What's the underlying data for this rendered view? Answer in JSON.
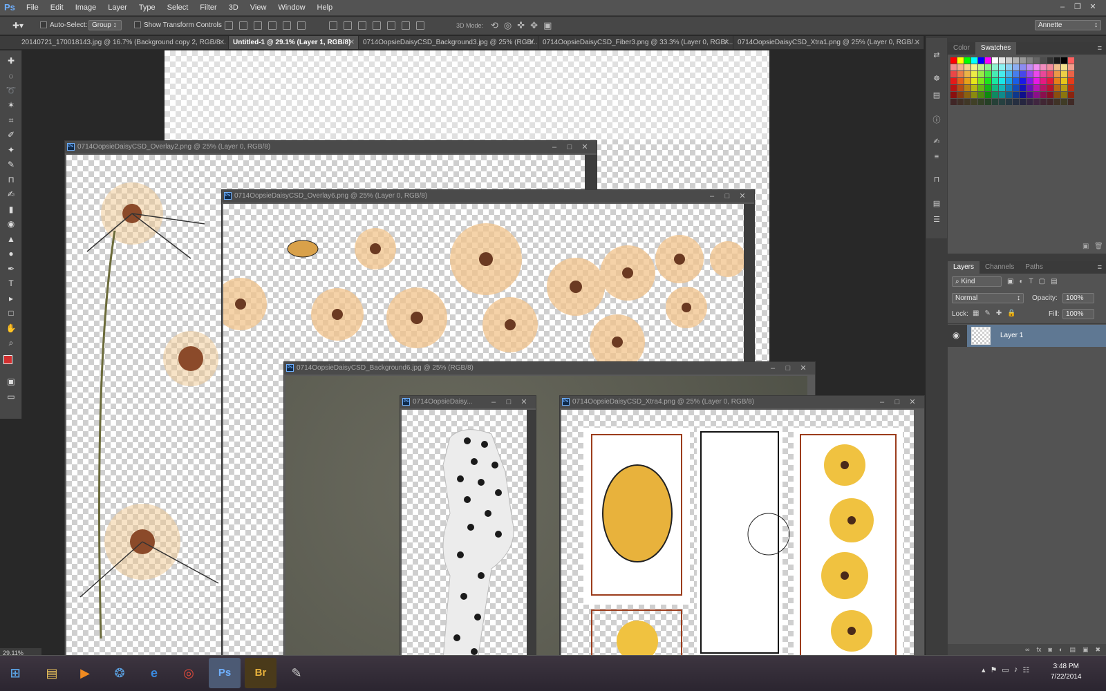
{
  "app": {
    "logo": "Ps"
  },
  "menu": [
    "File",
    "Edit",
    "Image",
    "Layer",
    "Type",
    "Select",
    "Filter",
    "3D",
    "View",
    "Window",
    "Help"
  ],
  "options": {
    "auto_select": "Auto-Select:",
    "group": "Group",
    "show_transform": "Show Transform Controls",
    "mode_3d": "3D Mode:",
    "workspace": "Annette"
  },
  "tabs": [
    "20140721_170018143.jpg @ 16.7% (Background copy 2, RGB/8...",
    "Untitled-1 @ 29.1% (Layer 1, RGB/8)",
    "0714OopsieDaisyCSD_Background3.jpg @ 25% (RGB/...",
    "0714OopsieDaisyCSD_Fiber3.png @ 33.3% (Layer 0, RGB/...",
    "0714OopsieDaisyCSD_Xtra1.png @ 25% (Layer 0, RGB/..."
  ],
  "windows": {
    "overlay2": "0714OopsieDaisyCSD_Overlay2.png @ 25% (Layer 0, RGB/8)",
    "overlay6": "0714OopsieDaisyCSD_Overlay6.png @ 25% (Layer 0, RGB/8)",
    "background6": "0714OopsieDaisyCSD_Background6.jpg @ 25% (RGB/8)",
    "fiber": "0714OopsieDaisy...",
    "xtra4": "0714OopsieDaisyCSD_Xtra4.png @ 25% (Layer 0, RGB/8)"
  },
  "color_panel": {
    "tabs": [
      "Color",
      "Swatches"
    ],
    "active": "Swatches"
  },
  "layers_panel": {
    "tabs": [
      "Layers",
      "Channels",
      "Paths"
    ],
    "filter": "Kind",
    "blend_mode": "Normal",
    "opacity_label": "Opacity:",
    "opacity": "100%",
    "lock_label": "Lock:",
    "fill_label": "Fill:",
    "fill": "100%",
    "layer_name": "Layer 1"
  },
  "status": {
    "zoom": "29.11%"
  },
  "taskbar": {
    "time": "3:48 PM",
    "date": "7/22/2014"
  },
  "colors": {
    "accent": "#6fb0ff",
    "selected_layer": "#5f7893",
    "foreground": "#d22f2f"
  }
}
